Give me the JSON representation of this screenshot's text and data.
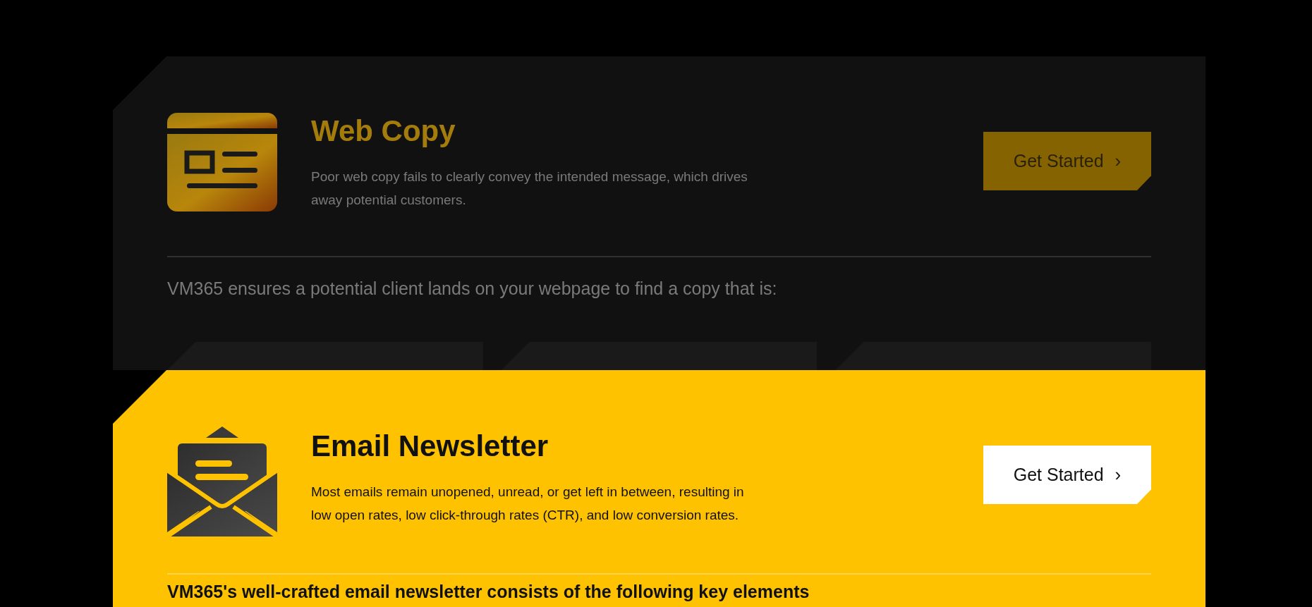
{
  "cards": [
    {
      "kind": "web",
      "highlighted": false,
      "title": "Web Copy",
      "description": "Poor web copy fails to clearly convey the intended message, which drives away potential customers.",
      "button": "Get Started",
      "button_icon": "›",
      "intro": "VM365 ensures a potential client lands on your webpage to find a copy that is:"
    },
    {
      "kind": "email",
      "highlighted": true,
      "title": "Email Newsletter",
      "description": "Most emails remain unopened, unread, or get left in between, resulting in low open rates, low click-through rates (CTR), and low conversion rates.",
      "button": "Get Started",
      "button_icon": "›",
      "intro": "VM365's well-crafted email newsletter consists of the following key elements"
    }
  ]
}
